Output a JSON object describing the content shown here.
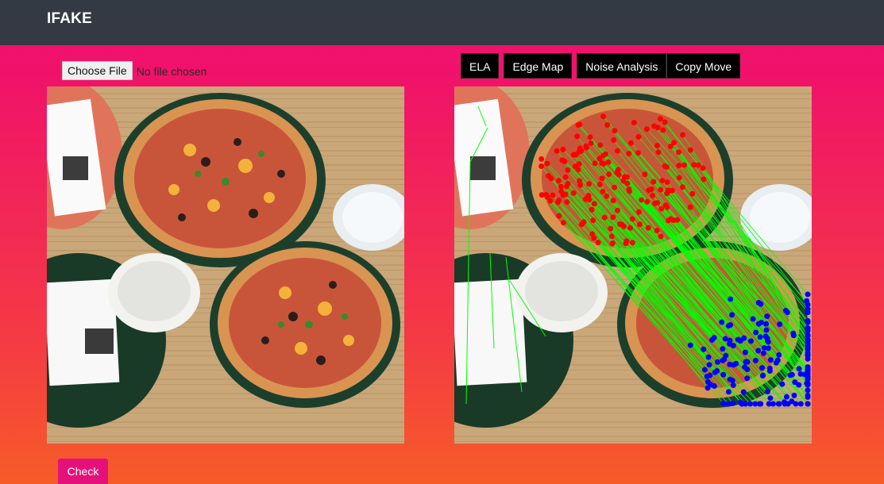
{
  "navbar": {
    "brand": "IFAKE"
  },
  "upload": {
    "button_label": "Choose File",
    "status": "No file chosen"
  },
  "tools": [
    {
      "label": "ELA"
    },
    {
      "label": "Edge Map"
    },
    {
      "label": "Noise Analysis"
    },
    {
      "label": "Copy Move"
    }
  ],
  "actions": {
    "check_label": "Check"
  },
  "colors": {
    "navbar": "#343a44",
    "gradient_top": "#f0106f",
    "gradient_bottom": "#f65c28",
    "keypoint_source": "#ff0000",
    "keypoint_match": "#0000ff",
    "match_line": "#00ff00"
  }
}
